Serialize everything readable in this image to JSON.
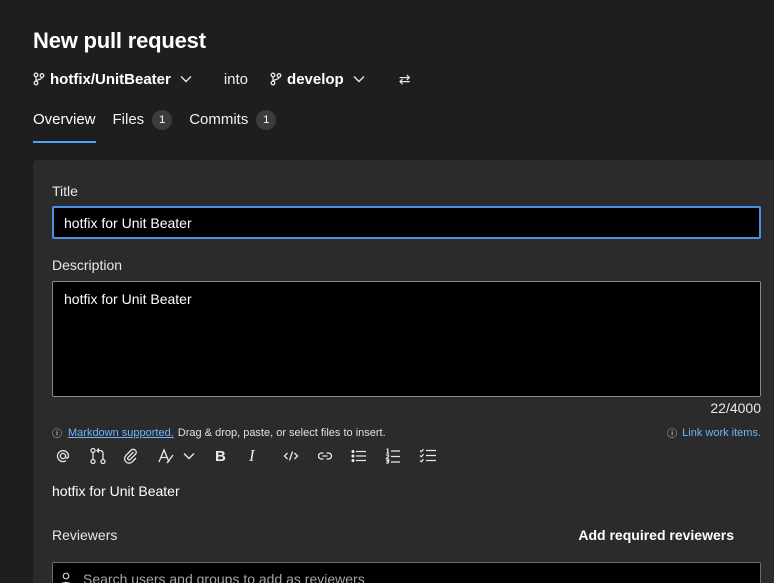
{
  "page": {
    "title": "New pull request"
  },
  "branches": {
    "source": "hotfix/UnitBeater",
    "connector": "into",
    "target": "develop",
    "swap_glyph": "⇄"
  },
  "tabs": [
    {
      "label": "Overview",
      "active": true
    },
    {
      "label": "Files",
      "count": "1"
    },
    {
      "label": "Commits",
      "count": "1"
    }
  ],
  "form": {
    "title_label": "Title",
    "title_value": "hotfix for Unit Beater",
    "description_label": "Description",
    "description_value": "hotfix for Unit Beater",
    "char_count": "22/4000",
    "markdown_link": "Markdown supported.",
    "markdown_hint": "Drag & drop, paste, or select files to insert.",
    "link_work_items": "Link work items.",
    "preview_text": "hotfix for Unit Beater"
  },
  "toolbar": {
    "items": [
      "mention-icon",
      "pull-request-icon",
      "attach-icon",
      "highlight-icon",
      "chevron-down-icon",
      "bold-icon",
      "italic-icon",
      "code-icon",
      "link-icon",
      "bullet-list-icon",
      "numbered-list-icon",
      "checklist-icon"
    ],
    "bold_glyph": "B",
    "italic_glyph": "I"
  },
  "reviewers": {
    "label": "Reviewers",
    "add_required": "Add required reviewers",
    "search_placeholder": "Search users and groups to add as reviewers"
  },
  "colors": {
    "background": "#1e1e1e",
    "card": "#2b2b2b",
    "accent": "#4a90e2",
    "link": "#6cb6ff"
  }
}
